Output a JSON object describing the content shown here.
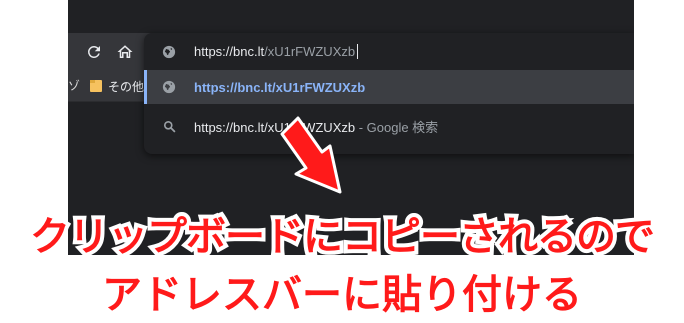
{
  "browser": {
    "bookmarks_bar": {
      "partial_left_text": "ゾ",
      "folder_label": "その他"
    },
    "omnibox": {
      "input_text_host": "https://bnc.lt",
      "input_text_path": "/xU1rFWZUXzb",
      "suggestions": [
        {
          "icon": "globe-icon",
          "text": "https://bnc.lt/xU1rFWZUXzb",
          "selected": true
        },
        {
          "icon": "search-icon",
          "text": "https://bnc.lt/xU1rFWZUXzb",
          "suffix": " - Google 検索",
          "selected": false
        }
      ]
    }
  },
  "annotation": {
    "arrow_color": "#ff1a1a",
    "caption_line1": "クリップボードにコピーされるので",
    "caption_line2": "アドレスバーに貼り付ける",
    "caption_color": "#ff1a1a"
  },
  "colors": {
    "background": "#202124",
    "toolbar": "#35363a",
    "selected_row": "#3c3e43",
    "link_blue": "#8ab4f8"
  }
}
